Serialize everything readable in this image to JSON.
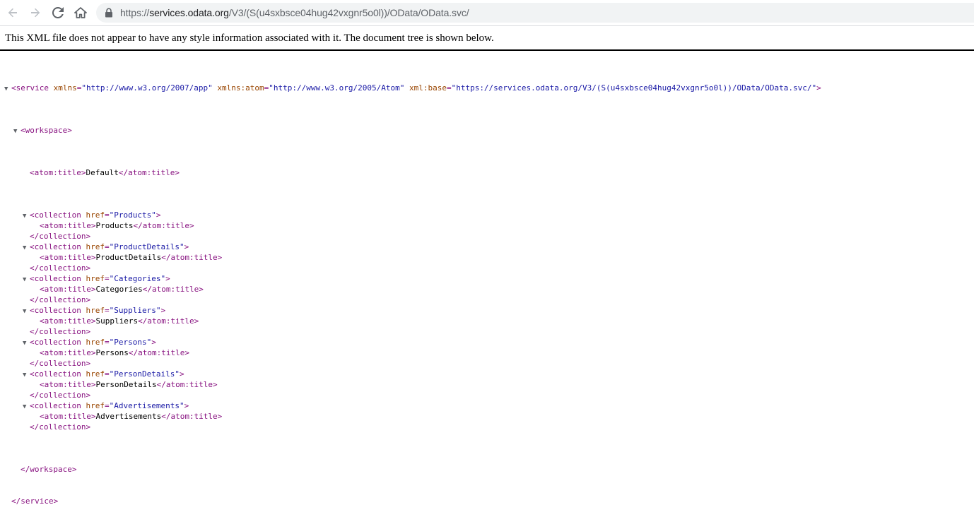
{
  "browser": {
    "url_protocol": "https://",
    "url_host": "services.odata.org",
    "url_path": "/V3/(S(u4sxbsce04hug42vxgnr5o0l))/OData/OData.svc/"
  },
  "xml_viewer": {
    "notice": "This XML file does not appear to have any style information associated with it. The document tree is shown below."
  },
  "xml": {
    "service": {
      "open": "<service",
      "xmlns_name": "xmlns",
      "xmlns_value": "\"http://www.w3.org/2007/app\"",
      "atom_name": "xmlns:atom",
      "atom_value": "\"http://www.w3.org/2005/Atom\"",
      "base_name": "xml:base",
      "base_value": "\"https://services.odata.org/V3/(S(u4sxbsce04hug42vxgnr5o0l))/OData/OData.svc/\"",
      "open_end": ">",
      "close": "</service>"
    },
    "workspace": {
      "open": "<workspace>",
      "close": "</workspace>",
      "title_open": "<atom:title>",
      "title_text": "Default",
      "title_close": "</atom:title>"
    },
    "collection_open": "<collection",
    "collection_close": "</collection>",
    "href_name": "href",
    "title_open": "<atom:title>",
    "title_close": "</atom:title>",
    "collections": [
      {
        "href": "\"Products\"",
        "title": "Products"
      },
      {
        "href": "\"ProductDetails\"",
        "title": "ProductDetails"
      },
      {
        "href": "\"Categories\"",
        "title": "Categories"
      },
      {
        "href": "\"Suppliers\"",
        "title": "Suppliers"
      },
      {
        "href": "\"Persons\"",
        "title": "Persons"
      },
      {
        "href": "\"PersonDetails\"",
        "title": "PersonDetails"
      },
      {
        "href": "\"Advertisements\"",
        "title": "Advertisements"
      }
    ],
    "toggle_glyph": "▼"
  },
  "colors": {
    "tag": "#881280",
    "attr_name": "#994500",
    "attr_value": "#1a1aa6",
    "text": "#000000"
  },
  "icons": [
    "back-arrow-icon",
    "forward-arrow-icon",
    "reload-icon",
    "home-icon",
    "lock-icon",
    "collapse-triangle-icon"
  ]
}
